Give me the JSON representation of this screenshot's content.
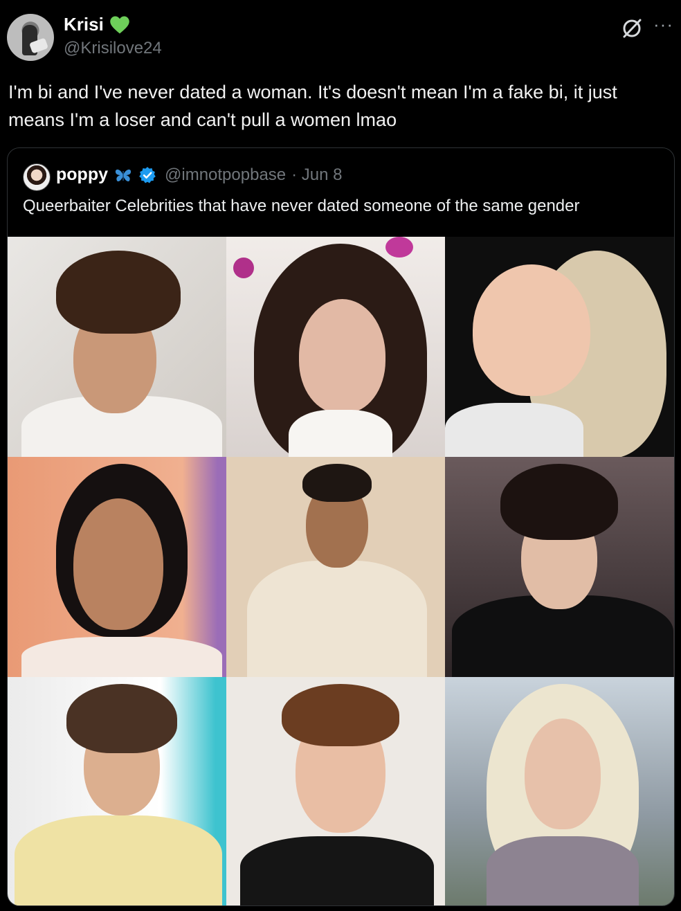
{
  "tweet": {
    "author": {
      "name": "Krisi",
      "handle": "@Krisilove24",
      "badge_icon": "green-heart-icon",
      "badge_color": "#6ecf5a"
    },
    "text": "I'm bi and I've never dated a woman. It's doesn't mean I'm a fake bi, it just means I'm a loser and can't pull a women lmao",
    "actions": {
      "grok_icon": "grok-icon",
      "more_label": "···"
    }
  },
  "quote": {
    "author": {
      "name": "poppy",
      "handle": "@imnotpopbase",
      "date": "· Jun 8",
      "emoji_icon": "butterfly-icon",
      "verified_icon": "verified-badge-icon",
      "verified_color": "#1d9bf0"
    },
    "text": "Queerbaiter Celebrities that have never dated someone of the same gender",
    "photos": [
      {
        "label": "photo-1"
      },
      {
        "label": "photo-2"
      },
      {
        "label": "photo-3"
      },
      {
        "label": "photo-4"
      },
      {
        "label": "photo-5"
      },
      {
        "label": "photo-6"
      },
      {
        "label": "photo-7"
      },
      {
        "label": "photo-8"
      },
      {
        "label": "photo-9"
      }
    ]
  },
  "colors": {
    "background": "#000000",
    "text": "#e7e9ea",
    "secondary_text": "#71767b",
    "border": "#2f3336"
  }
}
